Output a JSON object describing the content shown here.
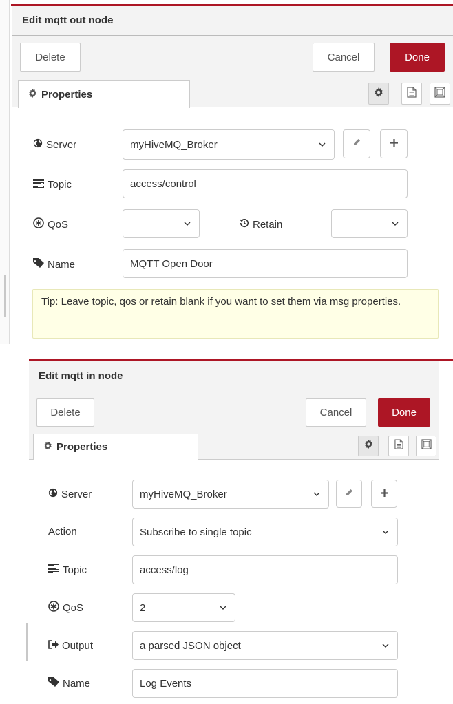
{
  "panel1": {
    "title": "Edit mqtt out node",
    "delete_label": "Delete",
    "cancel_label": "Cancel",
    "done_label": "Done",
    "tab_label": "Properties",
    "server_label": "Server",
    "server_value": "myHiveMQ_Broker",
    "topic_label": "Topic",
    "topic_value": "access/control",
    "qos_label": "QoS",
    "qos_value": "",
    "retain_label": "Retain",
    "retain_value": "",
    "name_label": "Name",
    "name_value": "MQTT Open Door",
    "tip_text": "Tip: Leave topic, qos or retain blank if you want to set them via msg properties."
  },
  "panel2": {
    "title": "Edit mqtt in node",
    "delete_label": "Delete",
    "cancel_label": "Cancel",
    "done_label": "Done",
    "tab_label": "Properties",
    "server_label": "Server",
    "server_value": "myHiveMQ_Broker",
    "action_label": "Action",
    "action_value": "Subscribe to single topic",
    "topic_label": "Topic",
    "topic_value": "access/log",
    "qos_label": "QoS",
    "qos_value": "2",
    "output_label": "Output",
    "output_value": "a parsed JSON object",
    "name_label": "Name",
    "name_value": "Log Events"
  },
  "colors": {
    "accent": "#ad1625",
    "tip_bg": "#ffffe6",
    "header_bg": "#f3f3f3"
  }
}
